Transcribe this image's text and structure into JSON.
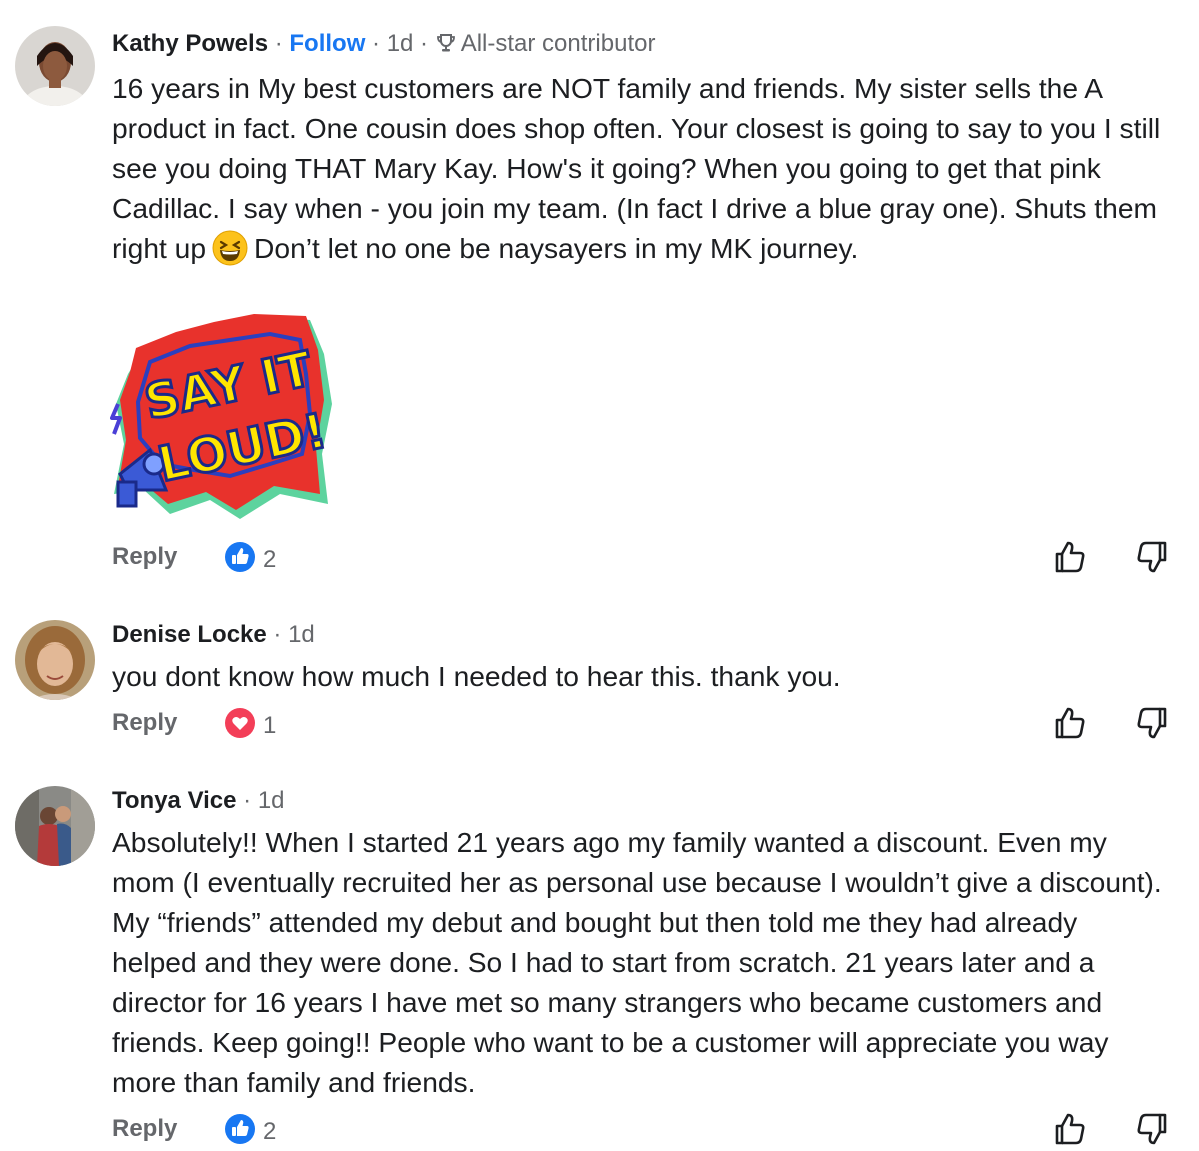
{
  "comments": [
    {
      "author": "Kathy Powels",
      "sep1": " · ",
      "follow_label": "Follow",
      "sep2": " · ",
      "time": "1d",
      "sep3": " · ",
      "badge": "All-star contributor",
      "badge_icon": "trophy-icon",
      "text_before_emoji": "16 years in My best customers are NOT family and friends. My sister sells the A product in fact. One cousin does shop often. Your closest is going to say to you I still see you doing THAT Mary Kay. How's it going? When you going to get that pink Cadillac. I say when - you join my team. (In fact I drive a blue gray one). Shuts them right up",
      "text_after_emoji": "Don’t let no one be naysayers in my MK journey.",
      "emoji": "grinning-squinting-face",
      "sticker_text": [
        "SAY IT",
        "LOUD!"
      ],
      "reply_label": "Reply",
      "reaction_icon": "like-icon",
      "reaction_count": "2"
    },
    {
      "author": "Denise Locke",
      "sep1": " · ",
      "time": "1d",
      "text": "you dont know how much I needed to hear this. thank you.",
      "reply_label": "Reply",
      "reaction_icon": "love-icon",
      "reaction_count": "1"
    },
    {
      "author": "Tonya Vice",
      "sep1": " · ",
      "time": "1d",
      "text": "Absolutely!! When I started 21 years ago my family wanted a discount. Even my mom (I eventually recruited her as personal use because I wouldn’t give a discount). My “friends” attended my debut and bought but then told me they had already helped and they were done. So I had to start from scratch. 21 years later and a director for 16 years I have met so many strangers who became customers and friends. Keep going!! People who want to be a customer will appreciate you way more than family and friends.",
      "reply_label": "Reply",
      "reaction_icon": "like-icon",
      "reaction_count": "2"
    }
  ],
  "colors": {
    "link": "#1877f2",
    "like": "#1877f2",
    "love": "#f33e58",
    "meta": "#65676b",
    "text": "#1c1e21"
  }
}
